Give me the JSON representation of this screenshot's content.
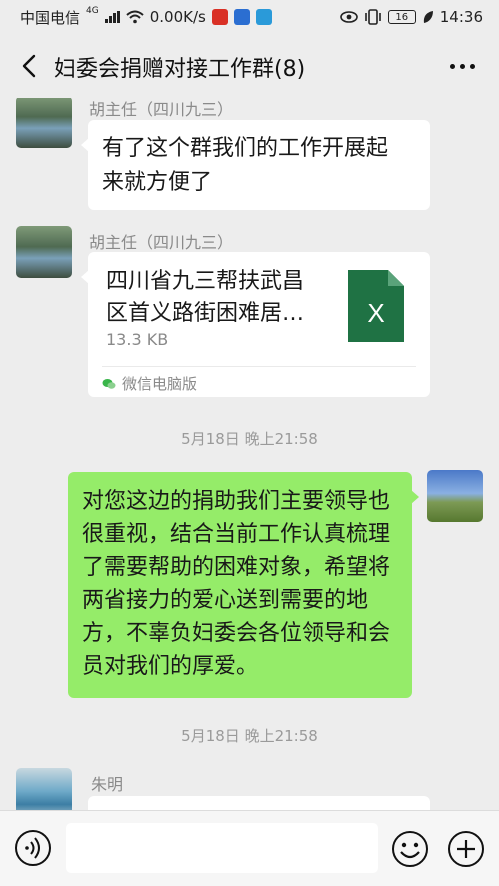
{
  "status_bar": {
    "carrier": "中国电信",
    "network": "4G",
    "speed": "0.00K/s",
    "battery": "16",
    "time": "14:36"
  },
  "header": {
    "back_icon": "chevron-left-icon",
    "title": "妇委会捐赠对接工作群(8)",
    "more_icon": "more-dots-icon"
  },
  "messages": {
    "m1": {
      "sender": "胡主任（四川九三）",
      "text_l1": "有了这个群我们的工作开展起",
      "text_l2": "来就方便了"
    },
    "m2": {
      "sender": "胡主任（四川九三）",
      "file_name_l1": "四川省九三帮扶武昌",
      "file_name_l2": "区首义路街困难居…",
      "file_size": "13.3 KB",
      "file_icon_label": "X",
      "source": "微信电脑版"
    },
    "time1": "5月18日 晚上21:58",
    "m3": {
      "lines": [
        "对您这边的捐助我们主要领导也",
        "很重视，结合当前工作认真梳理",
        "了需要帮助的困难对象，希望将",
        "两省接力的爱心送到需要的地",
        "方，不辜负妇委会各位领导和会",
        "员对我们的厚爱。"
      ]
    },
    "time2": "5月18日 晚上21:58",
    "m4": {
      "sender": "朱明"
    }
  },
  "input_bar": {
    "voice_icon": "voice-icon",
    "input_value": "",
    "emoji_icon": "emoji-icon",
    "plus_icon": "plus-icon"
  },
  "colors": {
    "background": "#ededed",
    "self_bubble": "#95ec69",
    "other_bubble": "#ffffff",
    "excel_green": "#1f7244"
  }
}
